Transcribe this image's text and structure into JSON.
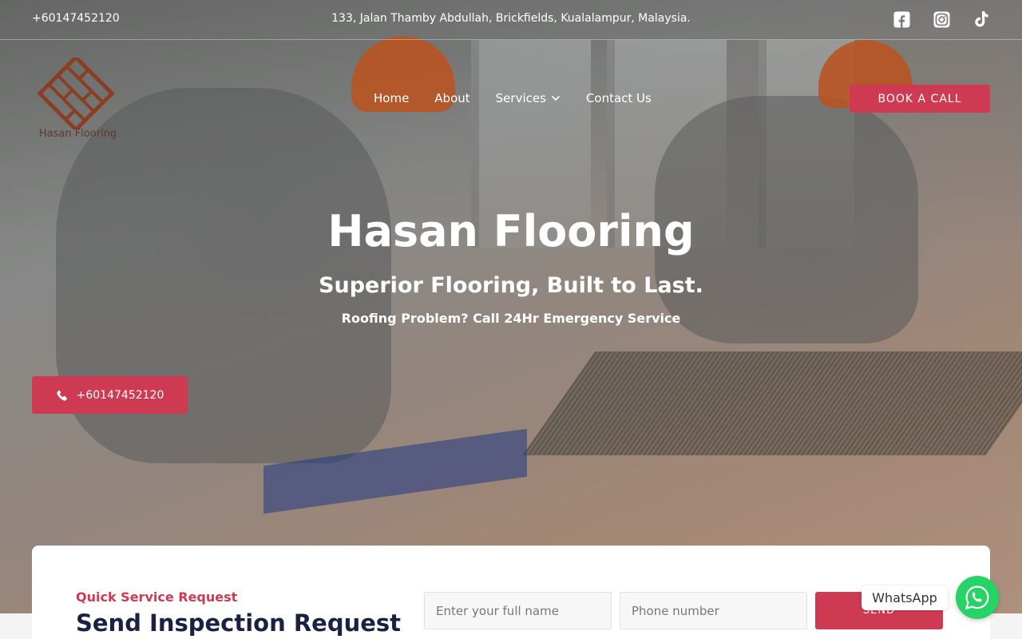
{
  "topbar": {
    "phone": "+60147452120",
    "address": "133, Jalan Thamby Abdullah, Brickfields, Kualalampur, Malaysia.",
    "socials": [
      "facebook-icon",
      "instagram-icon",
      "tiktok-icon"
    ]
  },
  "header": {
    "logo_text": "Hasan Flooring",
    "nav": [
      {
        "label": "Home"
      },
      {
        "label": "About"
      },
      {
        "label": "Services"
      },
      {
        "label": "Contact Us"
      }
    ],
    "book_label": "BOOK A CALL"
  },
  "hero": {
    "title": "Hasan Flooring",
    "subtitle": "Superior Flooring, Built to Last.",
    "tagline": "Roofing Problem? Call 24Hr Emergency Service",
    "call_label": "+60147452120"
  },
  "form": {
    "eyebrow": "Quick Service Request",
    "title": "Send Inspection Request",
    "name_placeholder": "Enter your full name",
    "phone_placeholder": "Phone number",
    "send_label": "SEND"
  },
  "whatsapp": {
    "label": "WhatsApp"
  },
  "colors": {
    "accent": "#cd3a51",
    "heading_dark": "#1b2142",
    "whatsapp_green": "#25d366",
    "logo_brown": "#8a3f25"
  }
}
